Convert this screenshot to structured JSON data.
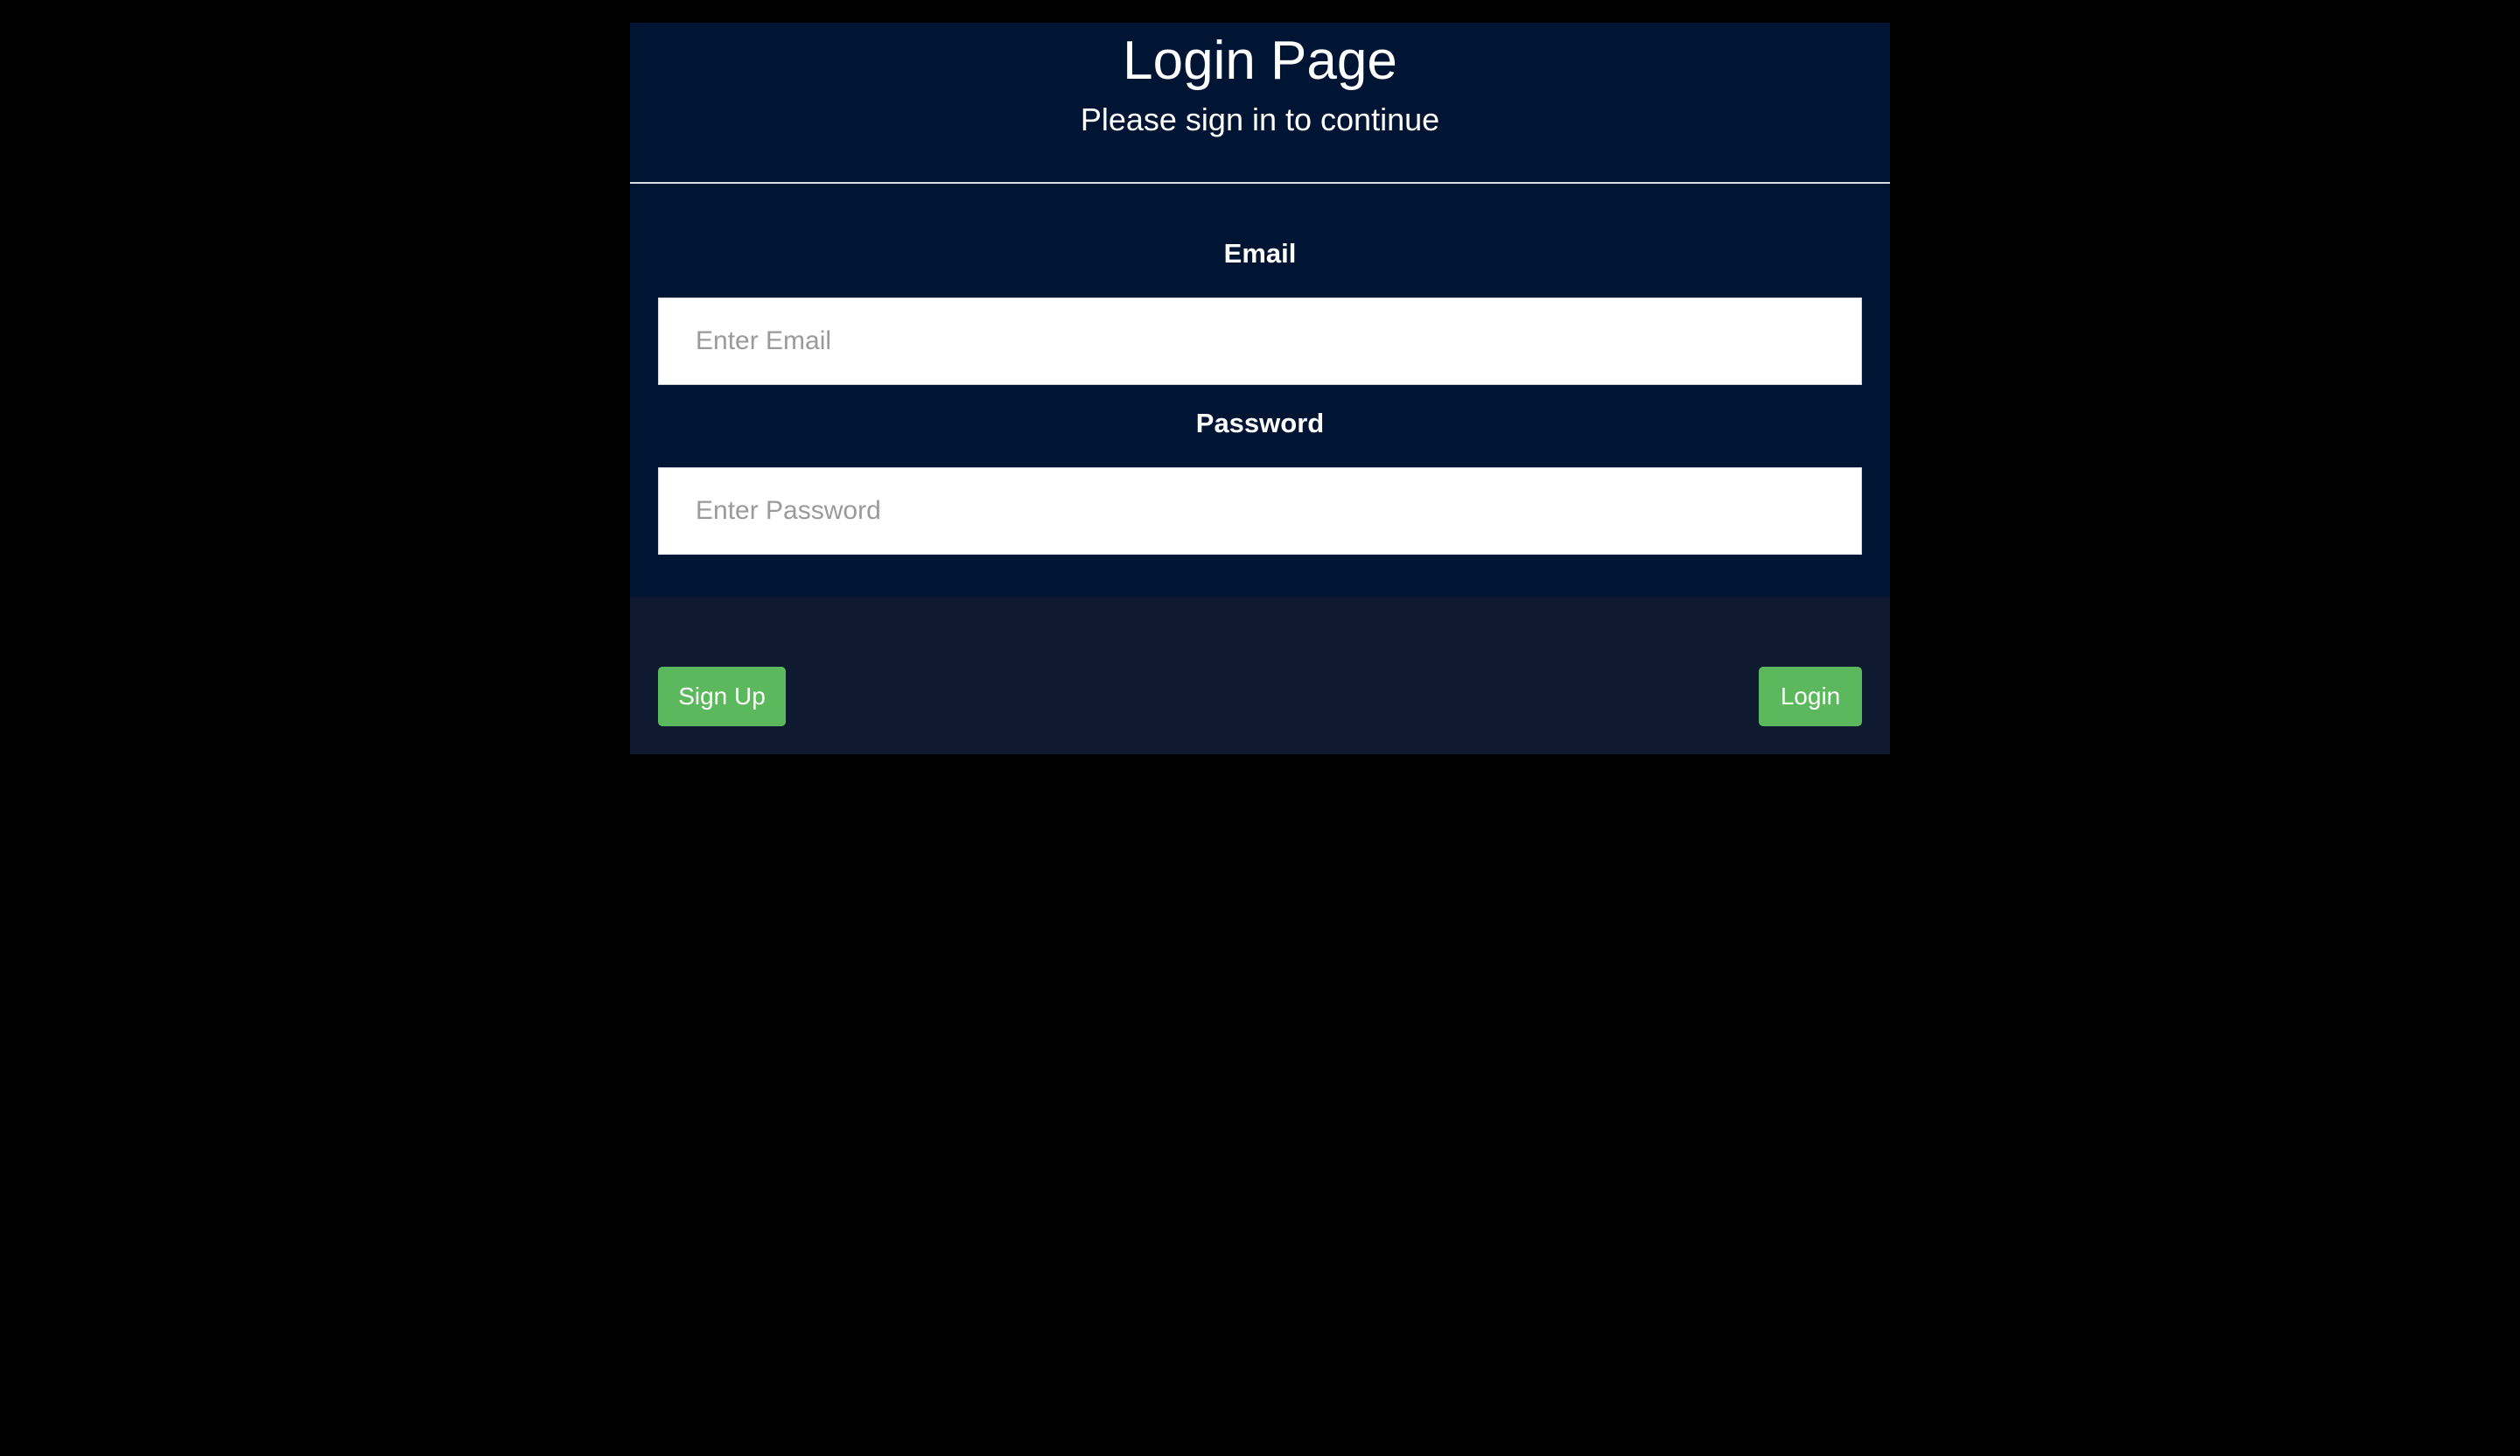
{
  "header": {
    "title": "Login Page",
    "subtitle": "Please sign in to continue"
  },
  "form": {
    "email_label": "Email",
    "email_placeholder": "Enter Email",
    "email_value": "",
    "password_label": "Password",
    "password_placeholder": "Enter Password",
    "password_value": ""
  },
  "footer": {
    "signup_label": "Sign Up",
    "login_label": "Login"
  },
  "colors": {
    "page_background": "#000000",
    "card_background": "#001533",
    "footer_background": "#0f1a30",
    "button_green": "#5cb85c"
  }
}
